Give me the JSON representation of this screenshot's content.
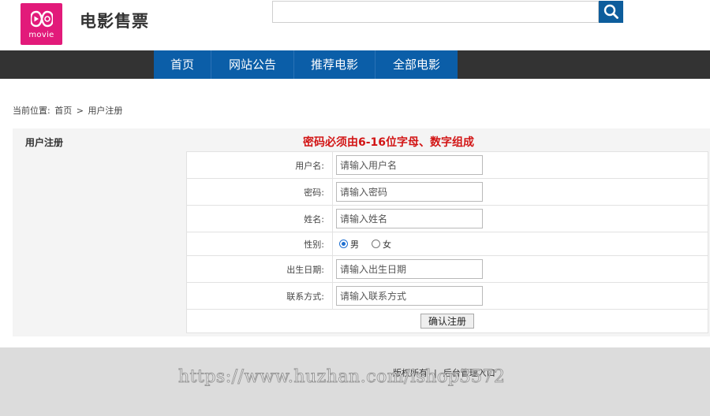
{
  "header": {
    "logo_text": "movie",
    "site_title": "电影售票",
    "search": {
      "value": "",
      "placeholder": ""
    },
    "search_icon": "search-icon",
    "brand_color": "#e21a7a"
  },
  "nav": {
    "items": [
      {
        "label": "首页"
      },
      {
        "label": "网站公告"
      },
      {
        "label": "推荐电影"
      },
      {
        "label": "全部电影"
      }
    ],
    "color": "#0b5ea8"
  },
  "breadcrumb": {
    "prefix": "当前位置:",
    "home": "首页",
    "separator": ">",
    "current": "用户注册"
  },
  "panel": {
    "title": "用户注册",
    "notice": "密码必须由6-16位字母、数字组成",
    "notice_color": "#d21414"
  },
  "form": {
    "username": {
      "label": "用户名:",
      "placeholder": "请输入用户名",
      "value": ""
    },
    "password": {
      "label": "密码:",
      "placeholder": "请输入密码",
      "value": ""
    },
    "name": {
      "label": "姓名:",
      "placeholder": "请输入姓名",
      "value": ""
    },
    "gender": {
      "label": "性别:",
      "options": [
        "男",
        "女"
      ],
      "selected": "男"
    },
    "birthday": {
      "label": "出生日期:",
      "placeholder": "请输入出生日期",
      "value": ""
    },
    "contact": {
      "label": "联系方式:",
      "placeholder": "请输入联系方式",
      "value": ""
    },
    "submit_label": "确认注册"
  },
  "footer": {
    "copyright": "版权所有",
    "separator": "|",
    "admin_link": "后台管理入口"
  },
  "watermark": "https://www.huzhan.com/ishop3572"
}
